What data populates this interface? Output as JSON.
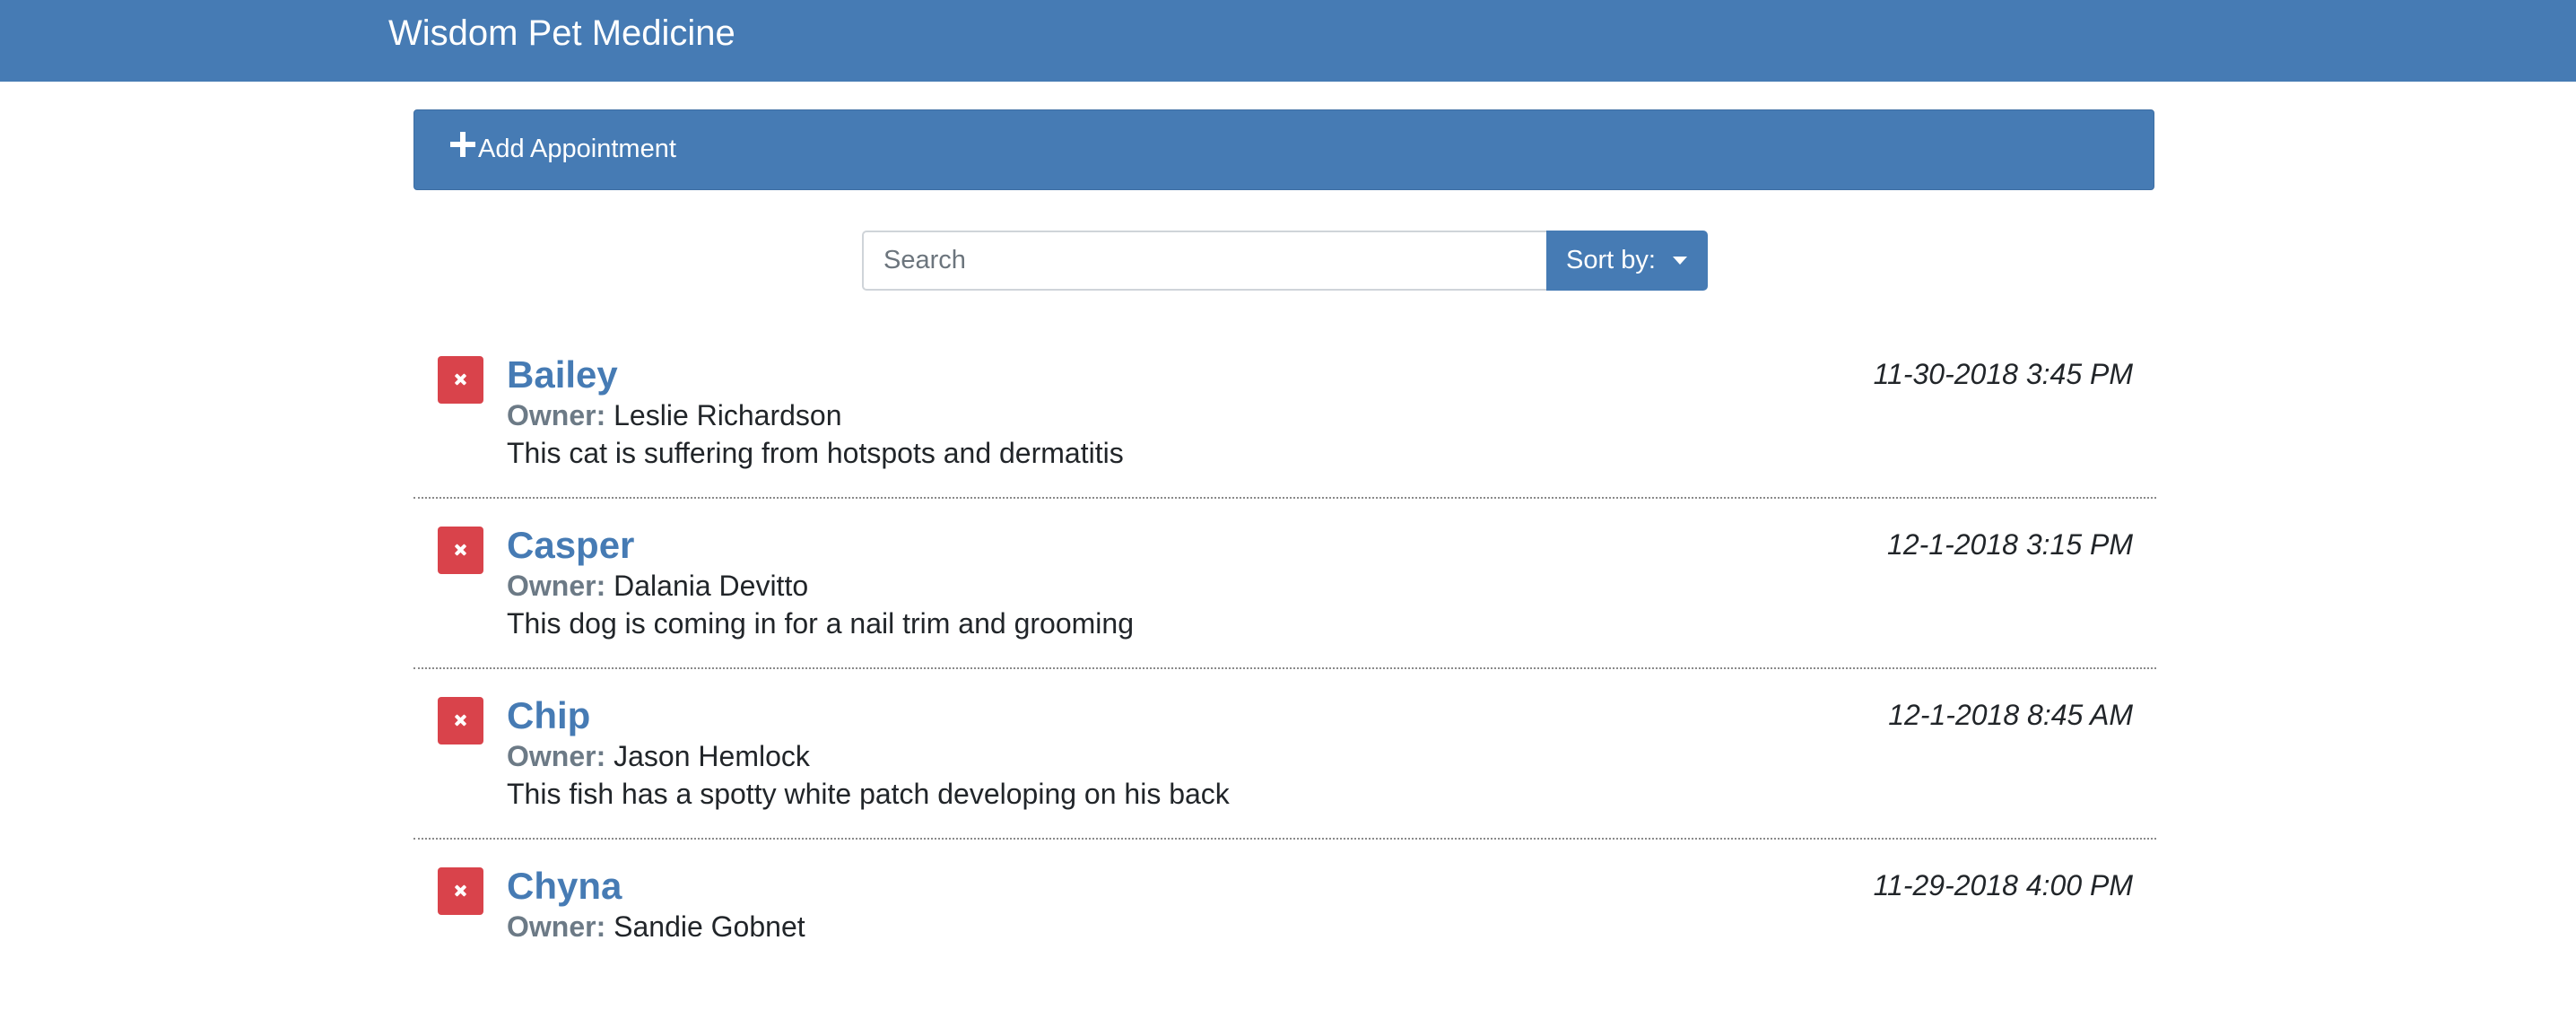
{
  "app": {
    "brand": "Wisdom Pet Medicine"
  },
  "add_appointment": {
    "label": "Add Appointment",
    "icon": "plus-icon"
  },
  "search": {
    "placeholder": "Search",
    "value": ""
  },
  "sort": {
    "label": "Sort by:",
    "icon": "caret-down-icon"
  },
  "appointments": [
    {
      "pet_name": "Bailey",
      "owner_label": "Owner:",
      "owner_name": "Leslie Richardson",
      "notes": "This cat is suffering from hotspots and dermatitis",
      "date": "11-30-2018 3:45 PM"
    },
    {
      "pet_name": "Casper",
      "owner_label": "Owner:",
      "owner_name": "Dalania Devitto",
      "notes": "This dog is coming in for a nail trim and grooming",
      "date": "12-1-2018 3:15 PM"
    },
    {
      "pet_name": "Chip",
      "owner_label": "Owner:",
      "owner_name": "Jason Hemlock",
      "notes": "This fish has a spotty white patch developing on his back",
      "date": "12-1-2018 8:45 AM"
    },
    {
      "pet_name": "Chyna",
      "owner_label": "Owner:",
      "owner_name": "Sandie Gobnet",
      "notes": "",
      "date": "11-29-2018 4:00 PM"
    }
  ],
  "colors": {
    "primary": "#467bb4",
    "danger": "#d9434b",
    "owner_label": "#6c7a86"
  }
}
